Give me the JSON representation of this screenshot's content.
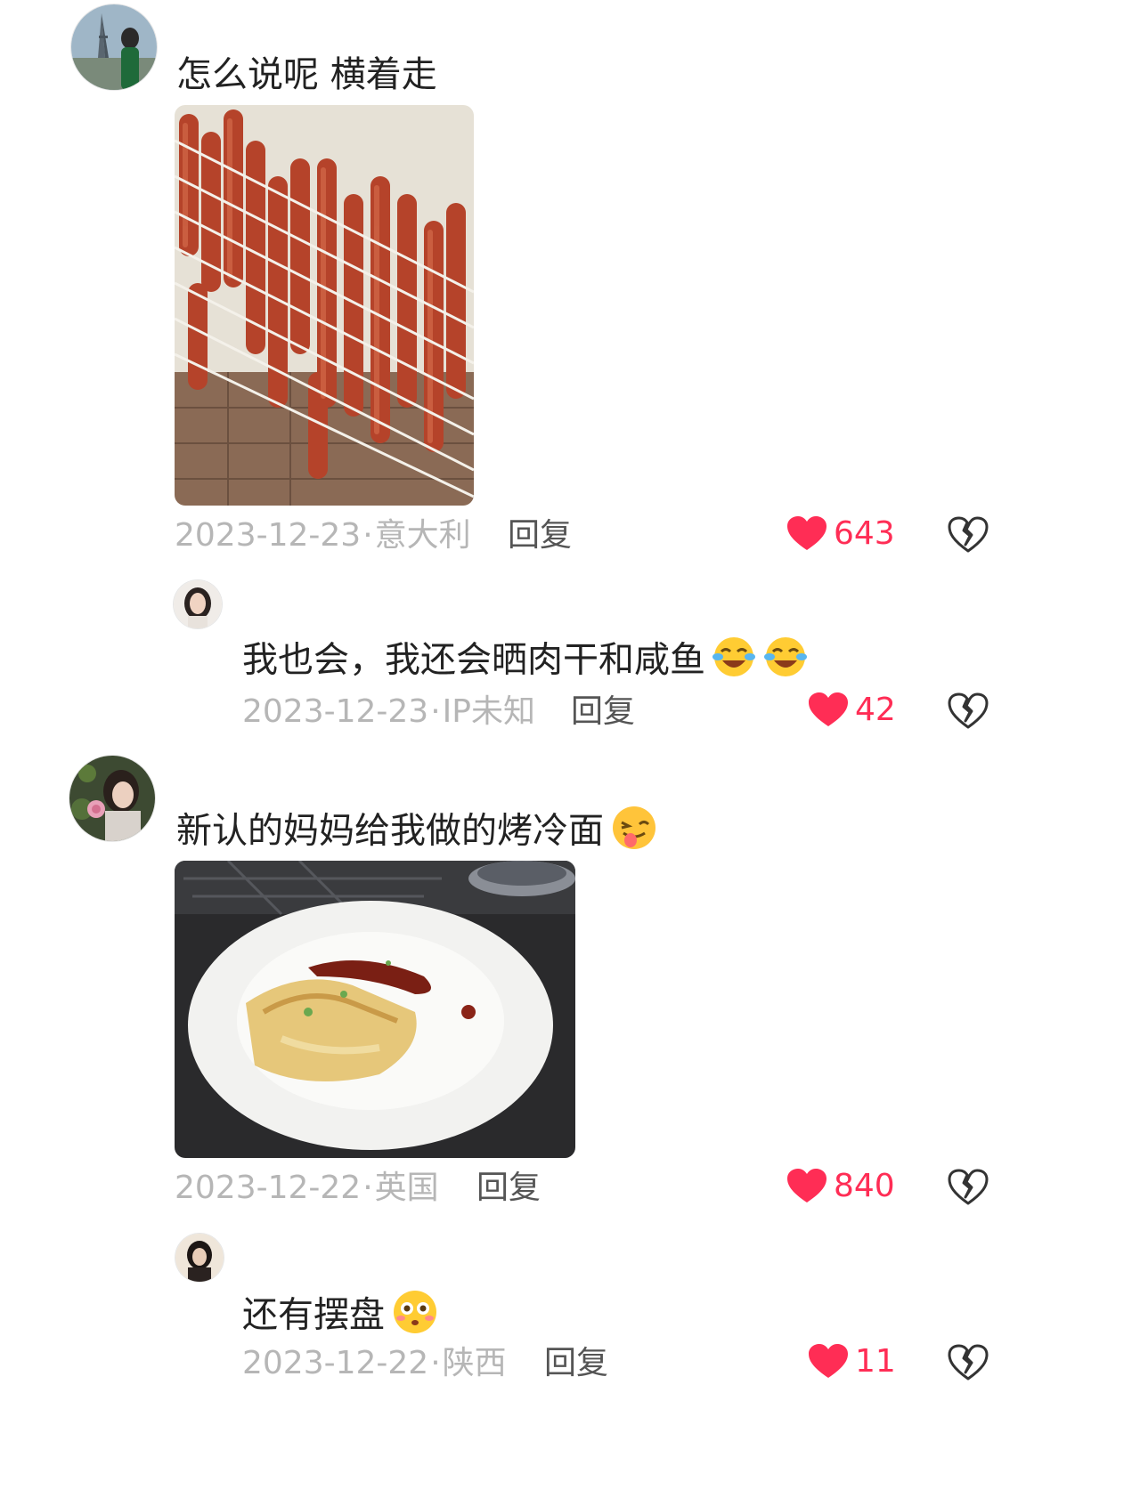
{
  "colors": {
    "like": "#ff2d55",
    "meta": "#b6b6b6",
    "text": "#222222"
  },
  "comments": [
    {
      "text": "怎么说呢 横着走",
      "date": "2023-12-23",
      "location": "意大利",
      "reply_label": "回复",
      "likes": "643",
      "image": "sausage-drying-photo",
      "replies": [
        {
          "text": "我也会，我还会晒肉干和咸鱼",
          "emojis": [
            "crying-laughing-emoji",
            "crying-laughing-emoji"
          ],
          "date": "2023-12-23",
          "location": "IP未知",
          "reply_label": "回复",
          "likes": "42"
        }
      ]
    },
    {
      "text": "新认的妈妈给我做的烤冷面",
      "emojis": [
        "winking-tongue-emoji"
      ],
      "date": "2023-12-22",
      "location": "英国",
      "reply_label": "回复",
      "likes": "840",
      "image": "plated-dish-photo",
      "replies": [
        {
          "text": "还有摆盘",
          "emojis": [
            "flushed-face-emoji"
          ],
          "date": "2023-12-22",
          "location": "陕西",
          "reply_label": "回复",
          "likes": "11"
        }
      ]
    }
  ]
}
